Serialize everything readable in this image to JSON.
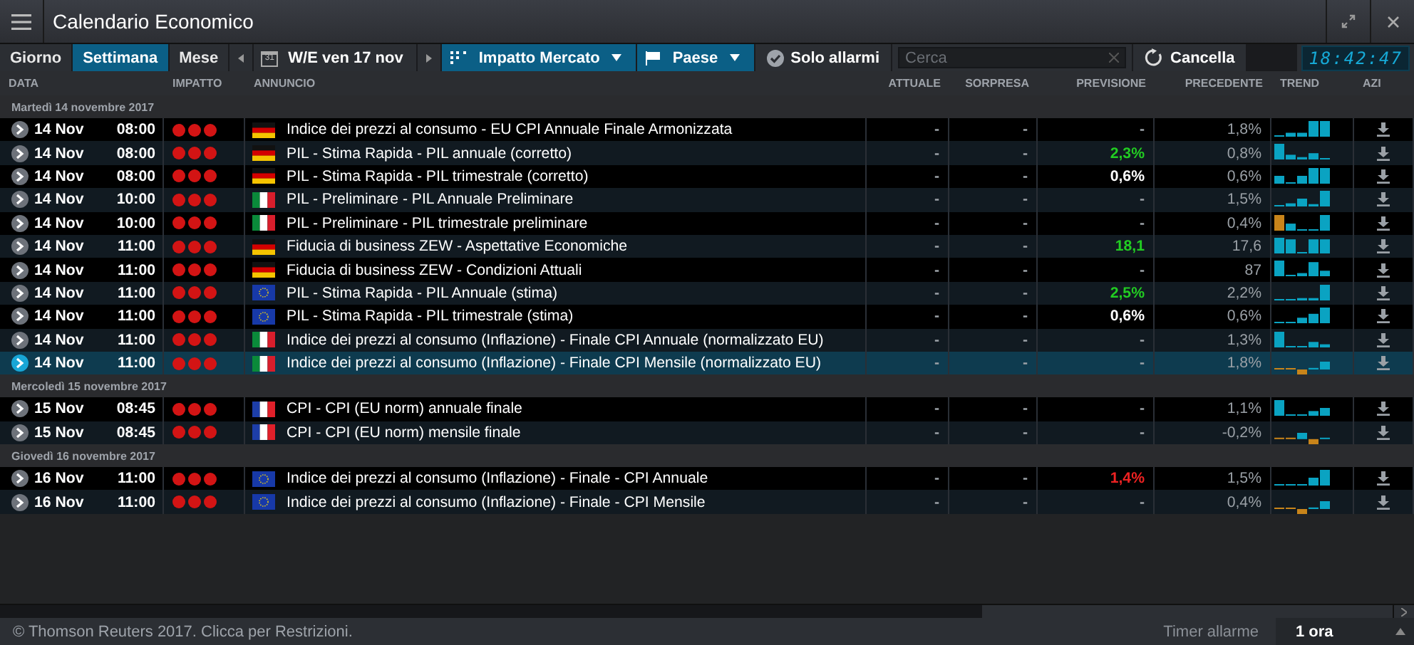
{
  "window": {
    "title": "Calendario Economico"
  },
  "toolbar": {
    "tabs": [
      {
        "label": "Giorno",
        "selected": false
      },
      {
        "label": "Settimana",
        "selected": true
      },
      {
        "label": "Mese",
        "selected": false
      }
    ],
    "week": "W/E ven 17 nov",
    "calendar_day": "31",
    "impact_filter": "Impatto Mercato",
    "country_filter": "Paese",
    "alerts_only": {
      "label": "Solo allarmi",
      "checked": true
    },
    "search": {
      "placeholder": "Cerca"
    },
    "clear": "Cancella",
    "clock": "18:42:47"
  },
  "table": {
    "columns": [
      "DATA",
      "IMPATTO",
      "ANNUNCIO",
      "ATTUALE",
      "SORPRESA",
      "PREVISIONE",
      "PRECEDENTE",
      "TREND",
      "AZI"
    ],
    "groups": [
      {
        "label": "Martedì 14 novembre 2017",
        "rows": [
          {
            "date": "14 Nov",
            "time": "08:00",
            "flag": {
              "kind": "de"
            },
            "title": "Indice dei prezzi al consumo - EU CPI Annuale Finale Armonizzata",
            "actual": "-",
            "surprise": "-",
            "forecast": {
              "text": "-",
              "color": "#9aa0a6"
            },
            "previous": "1,8%",
            "selected": false
          },
          {
            "date": "14 Nov",
            "time": "08:00",
            "flag": {
              "kind": "de"
            },
            "title": "PIL - Stima Rapida - PIL annuale (corretto)",
            "actual": "-",
            "surprise": "-",
            "forecast": {
              "text": "2,3%",
              "color": "#22cc22"
            },
            "previous": "0,8%",
            "selected": false
          },
          {
            "date": "14 Nov",
            "time": "08:00",
            "flag": {
              "kind": "de"
            },
            "title": "PIL - Stima Rapida - PIL trimestrale (corretto)",
            "actual": "-",
            "surprise": "-",
            "forecast": {
              "text": "0,6%",
              "color": "#ffffff"
            },
            "previous": "0,6%",
            "selected": false
          },
          {
            "date": "14 Nov",
            "time": "10:00",
            "flag": {
              "kind": "it"
            },
            "title": "PIL - Preliminare - PIL Annuale Preliminare",
            "actual": "-",
            "surprise": "-",
            "forecast": {
              "text": "-",
              "color": "#9aa0a6"
            },
            "previous": "1,5%",
            "selected": false
          },
          {
            "date": "14 Nov",
            "time": "10:00",
            "flag": {
              "kind": "it"
            },
            "title": "PIL - Preliminare - PIL trimestrale preliminare",
            "actual": "-",
            "surprise": "-",
            "forecast": {
              "text": "-",
              "color": "#9aa0a6"
            },
            "previous": "0,4%",
            "selected": false
          },
          {
            "date": "14 Nov",
            "time": "11:00",
            "flag": {
              "kind": "de"
            },
            "title": "Fiducia di business ZEW - Aspettative Economiche",
            "actual": "-",
            "surprise": "-",
            "forecast": {
              "text": "18,1",
              "color": "#22cc22"
            },
            "previous": "17,6",
            "selected": false
          },
          {
            "date": "14 Nov",
            "time": "11:00",
            "flag": {
              "kind": "de"
            },
            "title": "Fiducia di business ZEW - Condizioni Attuali",
            "actual": "-",
            "surprise": "-",
            "forecast": {
              "text": "-",
              "color": "#9aa0a6"
            },
            "previous": "87",
            "selected": false
          },
          {
            "date": "14 Nov",
            "time": "11:00",
            "flag": {
              "kind": "eu"
            },
            "title": "PIL - Stima Rapida - PIL Annuale (stima)",
            "actual": "-",
            "surprise": "-",
            "forecast": {
              "text": "2,5%",
              "color": "#22cc22"
            },
            "previous": "2,2%",
            "selected": false
          },
          {
            "date": "14 Nov",
            "time": "11:00",
            "flag": {
              "kind": "eu"
            },
            "title": "PIL - Stima Rapida - PIL trimestrale (stima)",
            "actual": "-",
            "surprise": "-",
            "forecast": {
              "text": "0,6%",
              "color": "#ffffff"
            },
            "previous": "0,6%",
            "selected": false
          },
          {
            "date": "14 Nov",
            "time": "11:00",
            "flag": {
              "kind": "it"
            },
            "title": "Indice dei prezzi al consumo (Inflazione) - Finale CPI Annuale (normalizzato EU)",
            "actual": "-",
            "surprise": "-",
            "forecast": {
              "text": "-",
              "color": "#9aa0a6"
            },
            "previous": "1,3%",
            "selected": false
          },
          {
            "date": "14 Nov",
            "time": "11:00",
            "flag": {
              "kind": "it"
            },
            "title": "Indice dei prezzi al consumo (Inflazione) - Finale CPI Mensile (normalizzato EU)",
            "actual": "-",
            "surprise": "-",
            "forecast": {
              "text": "-",
              "color": "#9aa0a6"
            },
            "previous": "1,8%",
            "selected": true
          }
        ]
      },
      {
        "label": "Mercoledì 15 novembre 2017",
        "rows": [
          {
            "date": "15 Nov",
            "time": "08:45",
            "flag": {
              "kind": "fr"
            },
            "title": "CPI - CPI (EU norm) annuale finale",
            "actual": "-",
            "surprise": "-",
            "forecast": {
              "text": "-",
              "color": "#9aa0a6"
            },
            "previous": "1,1%",
            "selected": false
          },
          {
            "date": "15 Nov",
            "time": "08:45",
            "flag": {
              "kind": "fr"
            },
            "title": "CPI - CPI (EU norm) mensile finale",
            "actual": "-",
            "surprise": "-",
            "forecast": {
              "text": "-",
              "color": "#9aa0a6"
            },
            "previous": "-0,2%",
            "selected": false
          }
        ]
      },
      {
        "label": "Giovedì 16 novembre 2017",
        "rows": [
          {
            "date": "16 Nov",
            "time": "11:00",
            "flag": {
              "kind": "eu"
            },
            "title": "Indice dei prezzi al consumo (Inflazione) - Finale - CPI Annuale",
            "actual": "-",
            "surprise": "-",
            "forecast": {
              "text": "1,4%",
              "color": "#ee2222"
            },
            "previous": "1,5%",
            "selected": false
          },
          {
            "date": "16 Nov",
            "time": "11:00",
            "flag": {
              "kind": "eu"
            },
            "title": "Indice dei prezzi al consumo (Inflazione) - Finale - CPI Mensile",
            "actual": "-",
            "surprise": "-",
            "forecast": {
              "text": "-",
              "color": "#9aa0a6"
            },
            "previous": "0,4%",
            "selected": false
          }
        ]
      }
    ]
  },
  "status_bar": {
    "copyright": "© Thomson Reuters 2017. Clicca per Restrizioni.",
    "timer_label": "Timer allarme",
    "timer_value": "1 ora"
  }
}
